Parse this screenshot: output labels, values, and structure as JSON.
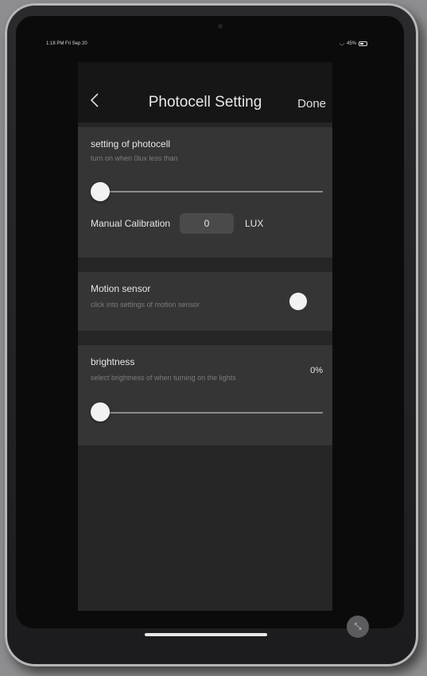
{
  "status_bar": {
    "time": "1:18 PM  Fri Sep 20",
    "battery": "45%"
  },
  "nav": {
    "title": "Photocell Setting",
    "done_label": "Done",
    "back_icon": "chevron-left-icon"
  },
  "photocell": {
    "title": "setting of photocell",
    "subtitle": "turn on when 0lux less than",
    "slider_value": 0,
    "calibration_label": "Manual Calibration",
    "calibration_value": "0",
    "calibration_unit": "LUX"
  },
  "motion": {
    "title": "Motion sensor",
    "subtitle": "click into settings of motion sensor",
    "toggle_on": true
  },
  "brightness": {
    "title": "brightness",
    "subtitle": "select brightness of when turning on the lights",
    "value_label": "0%",
    "slider_value": 0
  },
  "colors": {
    "background": "#262627",
    "card": "#353536",
    "navbar": "#161617"
  }
}
